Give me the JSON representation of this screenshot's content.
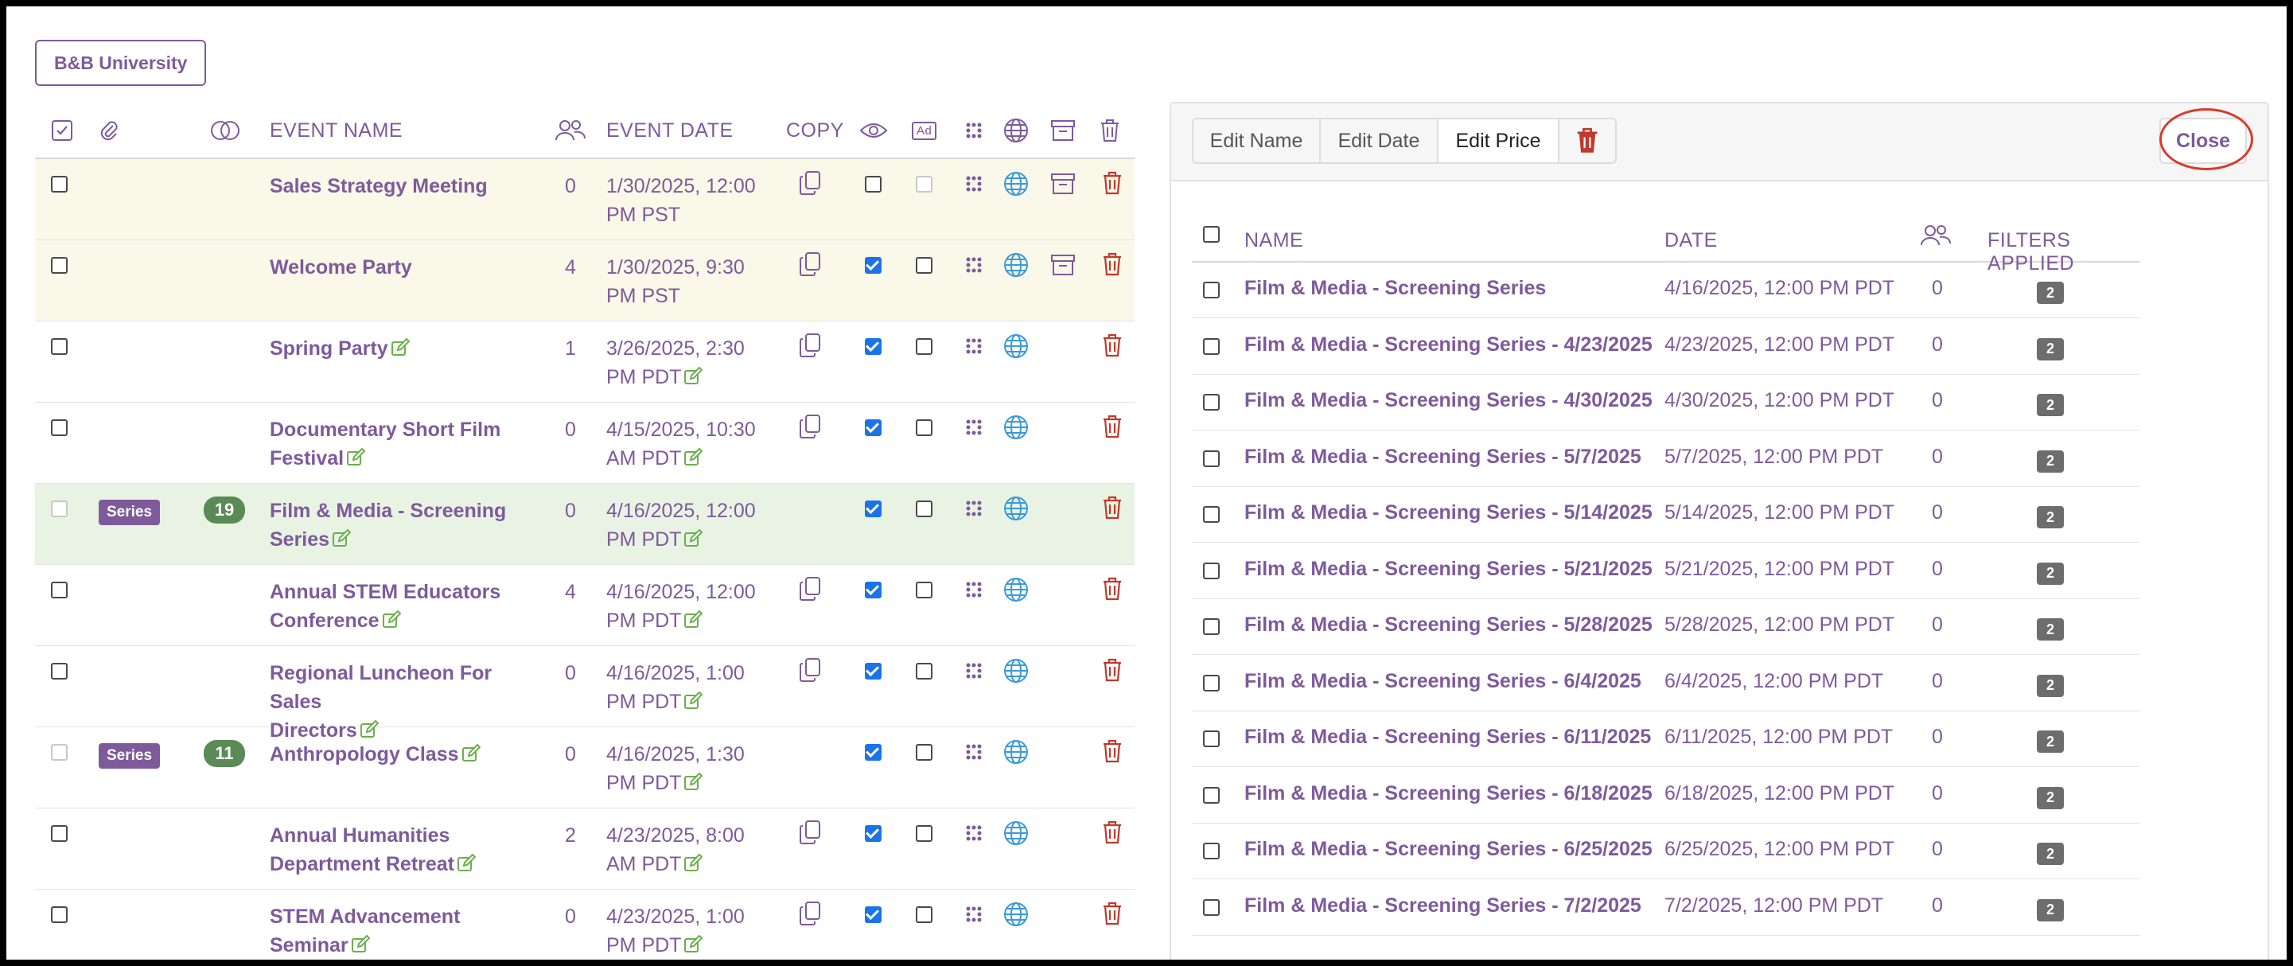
{
  "brand": {
    "label": "B&B University"
  },
  "left_table": {
    "headers": {
      "event_name": "EVENT NAME",
      "event_date": "EVENT DATE",
      "copy": "COPY",
      "ad": "Ad"
    },
    "rows": [
      {
        "name": "Sales Strategy Meeting",
        "name_lines": [
          "Sales Strategy Meeting"
        ],
        "attendees": "0",
        "date_lines": [
          "1/30/2025, 12:00",
          "PM PST"
        ],
        "highlight": "yellow",
        "series": false,
        "visible_checked": false,
        "ad_checked": false,
        "ad_disabled": true,
        "archive": true,
        "copy": true,
        "edit": false
      },
      {
        "name": "Welcome Party",
        "name_lines": [
          "Welcome Party"
        ],
        "attendees": "4",
        "date_lines": [
          "1/30/2025, 9:30",
          "PM PST"
        ],
        "highlight": "yellow",
        "series": false,
        "visible_checked": true,
        "ad_checked": false,
        "ad_disabled": false,
        "archive": true,
        "copy": true,
        "edit": false
      },
      {
        "name": "Spring Party",
        "name_lines": [
          "Spring Party"
        ],
        "attendees": "1",
        "date_lines": [
          "3/26/2025, 2:30",
          "PM PDT"
        ],
        "highlight": "none",
        "series": false,
        "visible_checked": true,
        "ad_checked": false,
        "ad_disabled": false,
        "archive": false,
        "copy": true,
        "edit": true
      },
      {
        "name": "Documentary Short Film Festival",
        "name_lines": [
          "Documentary Short Film",
          "Festival"
        ],
        "attendees": "0",
        "date_lines": [
          "4/15/2025, 10:30",
          "AM PDT"
        ],
        "highlight": "none",
        "series": false,
        "visible_checked": true,
        "ad_checked": false,
        "ad_disabled": false,
        "archive": false,
        "copy": true,
        "edit": true
      },
      {
        "name": "Film & Media - Screening Series",
        "name_lines": [
          "Film & Media - Screening",
          "Series"
        ],
        "attendees": "0",
        "date_lines": [
          "4/16/2025, 12:00",
          "PM PDT"
        ],
        "highlight": "green",
        "series": true,
        "series_label": "Series",
        "series_count": "19",
        "visible_checked": true,
        "ad_checked": false,
        "ad_disabled": false,
        "archive": false,
        "copy": false,
        "edit": true
      },
      {
        "name": "Annual STEM Educators Conference",
        "name_lines": [
          "Annual STEM Educators",
          "Conference"
        ],
        "attendees": "4",
        "date_lines": [
          "4/16/2025, 12:00",
          "PM PDT"
        ],
        "highlight": "none",
        "series": false,
        "visible_checked": true,
        "ad_checked": false,
        "ad_disabled": false,
        "archive": false,
        "copy": true,
        "edit": true
      },
      {
        "name": "Regional Luncheon For Sales Directors",
        "name_lines": [
          "Regional Luncheon For Sales",
          "Directors"
        ],
        "attendees": "0",
        "date_lines": [
          "4/16/2025, 1:00",
          "PM PDT"
        ],
        "highlight": "none",
        "series": false,
        "visible_checked": true,
        "ad_checked": false,
        "ad_disabled": false,
        "archive": false,
        "copy": true,
        "edit": true
      },
      {
        "name": "Anthropology Class",
        "name_lines": [
          "Anthropology Class"
        ],
        "attendees": "0",
        "date_lines": [
          "4/16/2025, 1:30",
          "PM PDT"
        ],
        "highlight": "none",
        "series": true,
        "series_label": "Series",
        "series_count": "11",
        "visible_checked": true,
        "ad_checked": false,
        "ad_disabled": false,
        "archive": false,
        "copy": false,
        "edit": true
      },
      {
        "name": "Annual Humanities Department Retreat",
        "name_lines": [
          "Annual Humanities",
          "Department Retreat"
        ],
        "attendees": "2",
        "date_lines": [
          "4/23/2025, 8:00",
          "AM PDT"
        ],
        "highlight": "none",
        "series": false,
        "visible_checked": true,
        "ad_checked": false,
        "ad_disabled": false,
        "archive": false,
        "copy": true,
        "edit": true
      },
      {
        "name": "STEM Advancement Seminar",
        "name_lines": [
          "STEM Advancement",
          "Seminar"
        ],
        "attendees": "0",
        "date_lines": [
          "4/23/2025, 1:00",
          "PM PDT"
        ],
        "highlight": "none",
        "series": false,
        "visible_checked": true,
        "ad_checked": false,
        "ad_disabled": false,
        "archive": false,
        "copy": true,
        "edit": true
      }
    ]
  },
  "right_panel": {
    "toolbar": {
      "edit_name": "Edit Name",
      "edit_date": "Edit Date",
      "edit_price": "Edit Price",
      "close": "Close"
    },
    "headers": {
      "name": "NAME",
      "date": "DATE",
      "filters": "FILTERS APPLIED"
    },
    "rows": [
      {
        "name": "Film & Media - Screening Series",
        "date": "4/16/2025, 12:00 PM PDT",
        "count": "0",
        "filters": "2"
      },
      {
        "name": "Film & Media - Screening Series - 4/23/2025",
        "date": "4/23/2025, 12:00 PM PDT",
        "count": "0",
        "filters": "2"
      },
      {
        "name": "Film & Media - Screening Series - 4/30/2025",
        "date": "4/30/2025, 12:00 PM PDT",
        "count": "0",
        "filters": "2"
      },
      {
        "name": "Film & Media - Screening Series - 5/7/2025",
        "date": "5/7/2025, 12:00 PM PDT",
        "count": "0",
        "filters": "2"
      },
      {
        "name": "Film & Media - Screening Series - 5/14/2025",
        "date": "5/14/2025, 12:00 PM PDT",
        "count": "0",
        "filters": "2"
      },
      {
        "name": "Film & Media - Screening Series - 5/21/2025",
        "date": "5/21/2025, 12:00 PM PDT",
        "count": "0",
        "filters": "2"
      },
      {
        "name": "Film & Media - Screening Series - 5/28/2025",
        "date": "5/28/2025, 12:00 PM PDT",
        "count": "0",
        "filters": "2"
      },
      {
        "name": "Film & Media - Screening Series - 6/4/2025",
        "date": "6/4/2025, 12:00 PM PDT",
        "count": "0",
        "filters": "2"
      },
      {
        "name": "Film & Media - Screening Series - 6/11/2025",
        "date": "6/11/2025, 12:00 PM PDT",
        "count": "0",
        "filters": "2"
      },
      {
        "name": "Film & Media - Screening Series - 6/18/2025",
        "date": "6/18/2025, 12:00 PM PDT",
        "count": "0",
        "filters": "2"
      },
      {
        "name": "Film & Media - Screening Series - 6/25/2025",
        "date": "6/25/2025, 12:00 PM PDT",
        "count": "0",
        "filters": "2"
      },
      {
        "name": "Film & Media - Screening Series - 7/2/2025",
        "date": "7/2/2025, 12:00 PM PDT",
        "count": "0",
        "filters": "2"
      }
    ]
  },
  "colors": {
    "brand_purple": "#7e5a9b",
    "delete_red": "#c0392b",
    "series_green": "#5a8a55",
    "row_yellow": "#faf8e8",
    "row_green": "#e8f3e4",
    "edit_green": "#6ab04c",
    "globe_blue": "#3a9ad9"
  }
}
